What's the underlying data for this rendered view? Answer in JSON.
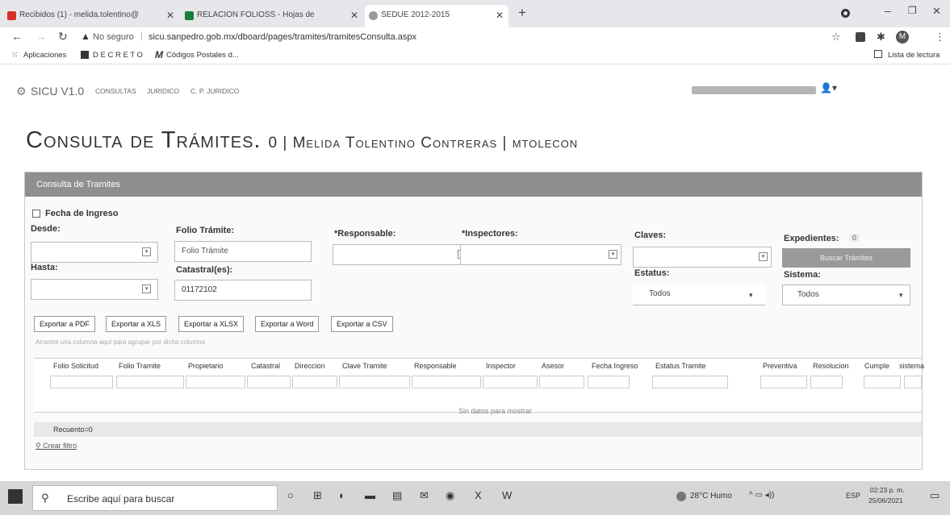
{
  "browser": {
    "tabs": [
      {
        "label": "Recibidos (1) - melida.tolentino@",
        "icon_color": "#d93025"
      },
      {
        "label": "RELACION FOLIOSS - Hojas de",
        "icon_color": "#188038"
      },
      {
        "label": "SEDUE 2012-2015",
        "icon_color": "#999999"
      }
    ],
    "address_warning": "No seguro",
    "url": "sicu.sanpedro.gob.mx/dboard/pages/tramites/tramitesConsulta.aspx",
    "bookmarks": [
      "Aplicaciones",
      "D E C R E T O",
      "Códigos Postales d..."
    ],
    "reading_list": "Lista de lectura",
    "avatar_letter": "M"
  },
  "app": {
    "logo": "SICU V1.0",
    "nav": [
      "CONSULTAS",
      "JURIDICO",
      "C. P. JURIDICO"
    ]
  },
  "page": {
    "title": "Consulta de Trámites.",
    "subtitle": "0 | Melida Tolentino Contreras | mtolecon"
  },
  "panel": {
    "header": "Consulta de Tramites",
    "fecha_ingreso": "Fecha de Ingreso",
    "desde": "Desde:",
    "hasta": "Hasta:",
    "folio_tramite_label": "Folio Trámite:",
    "folio_tramite_placeholder": "Folio Trámite",
    "catastral_label": "Catastral(es):",
    "catastral_value": "01172102",
    "responsable": "*Responsable:",
    "inspectores": "*Inspectores:",
    "claves": "Claves:",
    "estatus": "Estatus:",
    "estatus_value": "Todos",
    "expedientes": "Expedientes:",
    "expedientes_count": "0",
    "buscar": "Buscar Trámites",
    "sistema": "Sistema:",
    "sistema_value": "Todos"
  },
  "export_buttons": [
    "Exportar a PDF",
    "Exportar a XLS",
    "Exportar a XLSX",
    "Exportar a Word",
    "Exportar a CSV"
  ],
  "grid": {
    "group_hint": "Arrastre una columna aquí para agrupar por dicha columna",
    "columns": [
      "Folio Solicitud",
      "Folio Tramite",
      "Propietario",
      "Catastral",
      "Direccion",
      "Clave Tramite",
      "Responsable",
      "Inspector",
      "Asesor",
      "Fecha Ingreso",
      "Estatus Tramite",
      "Preventiva",
      "Resolucion",
      "Cumple",
      "sistema"
    ],
    "empty": "Sin datos para mostrar",
    "count": "Recuento=0",
    "filter_link": "Crear filtro"
  },
  "taskbar": {
    "search": "Escribe aquí para buscar",
    "weather": "28°C Humo",
    "lang": "ESP",
    "time": "02:23 p. m.",
    "date": "25/06/2021"
  }
}
